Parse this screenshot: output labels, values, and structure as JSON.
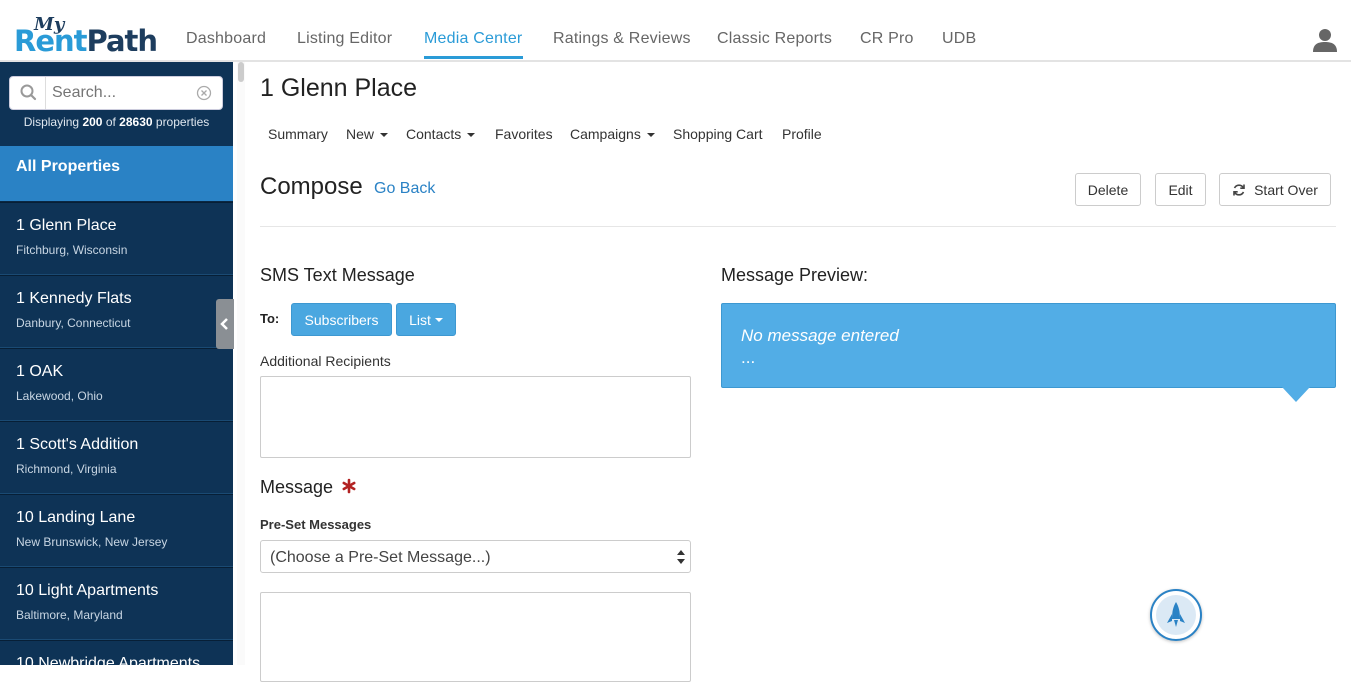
{
  "logo": {
    "my": "My",
    "rent": "Rent",
    "path": "Path"
  },
  "topnav": {
    "items": [
      "Dashboard",
      "Listing Editor",
      "Media Center",
      "Ratings & Reviews",
      "Classic Reports",
      "CR Pro",
      "UDB"
    ],
    "active": "Media Center",
    "accent": "#2a9bd7"
  },
  "sidebar": {
    "search_placeholder": "Search...",
    "displaying_prefix": "Displaying",
    "displaying_count": "200",
    "displaying_of": "of",
    "displaying_total": "28630",
    "displaying_suffix": "properties",
    "all_label": "All Properties",
    "properties": [
      {
        "name": "1 Glenn Place",
        "location": "Fitchburg, Wisconsin"
      },
      {
        "name": "1 Kennedy Flats",
        "location": "Danbury, Connecticut"
      },
      {
        "name": "1 OAK",
        "location": "Lakewood, Ohio"
      },
      {
        "name": "1 Scott's Addition",
        "location": "Richmond, Virginia"
      },
      {
        "name": "10 Landing Lane",
        "location": "New Brunswick, New Jersey"
      },
      {
        "name": "10 Light Apartments",
        "location": "Baltimore, Maryland"
      },
      {
        "name": "10 Newbridge Apartments",
        "location": ""
      }
    ],
    "bg_color": "#0e3356",
    "active_color": "#2a82c5"
  },
  "main": {
    "property_title": "1 Glenn Place",
    "subnav": {
      "summary": "Summary",
      "new": "New",
      "contacts": "Contacts",
      "favorites": "Favorites",
      "campaigns": "Campaigns",
      "shopping_cart": "Shopping Cart",
      "profile": "Profile"
    },
    "compose_title": "Compose",
    "go_back": "Go Back",
    "buttons": {
      "delete": "Delete",
      "edit": "Edit",
      "start_over": "Start Over"
    },
    "sms": {
      "title": "SMS Text Message",
      "to_label": "To:",
      "subscribers": "Subscribers",
      "list": "List",
      "additional_recipients": "Additional Recipients",
      "additional_value": "",
      "message_title": "Message",
      "preset_label": "Pre-Set Messages",
      "preset_selected": "(Choose a Pre-Set Message...)",
      "message_value": ""
    },
    "preview": {
      "title": "Message Preview:",
      "empty_text": "No message entered",
      "dots": "...",
      "color": "#52ade6"
    }
  }
}
